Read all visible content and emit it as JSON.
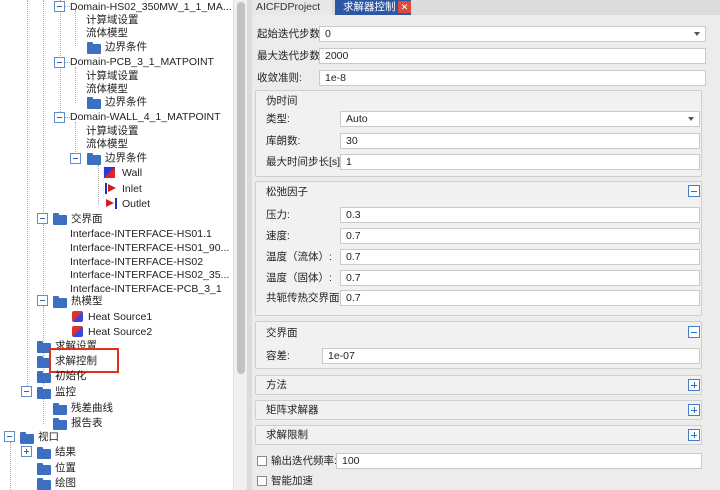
{
  "tree": {
    "domain_hs02": "Domain-HS02_350MW_1_1_MA...",
    "domain_pcb": "Domain-PCB_3_1_MATPOINT",
    "domain_wall": "Domain-WALL_4_1_MATPOINT",
    "calc_domain": "计算域设置",
    "fluid_model": "流体模型",
    "boundary": "边界条件",
    "bc_wall": "Wall",
    "bc_inlet": "Inlet",
    "bc_outlet": "Outlet",
    "interface": "交界面",
    "interfaces": [
      "Interface-INTERFACE-HS01.1",
      "Interface-INTERFACE-HS01_90...",
      "Interface-INTERFACE-HS02",
      "Interface-INTERFACE-HS02_35...",
      "Interface-INTERFACE-PCB_3_1"
    ],
    "thermal_model": "热模型",
    "heat_sources": [
      "Heat Source1",
      "Heat Source2"
    ],
    "solve_settings": "求解设置",
    "solver_control": "求解控制",
    "initialize": "初始化",
    "monitor": "监控",
    "residual": "残差曲线",
    "report": "报告表",
    "view": "视口",
    "results": "结果",
    "position": "位置",
    "plot": "绘图"
  },
  "tabs": {
    "project": "AICFDProject",
    "solver": "求解器控制",
    "close": "✕"
  },
  "form": {
    "start_iter_label": "起始迭代步数:",
    "start_iter_value": "0",
    "max_iter_label": "最大迭代步数:",
    "max_iter_value": "2000",
    "convergence_label": "收敛准则:",
    "convergence_value": "1e-8",
    "pseudo_time": {
      "title": "伪时间",
      "type_label": "类型:",
      "type_value": "Auto",
      "courant_label": "库朗数:",
      "courant_value": "30",
      "max_step_label": "最大时间步长[s]:",
      "max_step_value": "1"
    },
    "relaxation": {
      "title": "松弛因子",
      "pressure_label": "压力:",
      "pressure_value": "0.3",
      "velocity_label": "速度:",
      "velocity_value": "0.7",
      "temp_fluid_label": "温度（流体）:",
      "temp_fluid_value": "0.7",
      "temp_solid_label": "温度（固体）:",
      "temp_solid_value": "0.7",
      "cht_label": "共轭传热交界面:",
      "cht_value": "0.7"
    },
    "interface": {
      "title": "交界面",
      "tolerance_label": "容差:",
      "tolerance_value": "1e-07"
    },
    "method_title": "方法",
    "matrix_title": "矩阵求解器",
    "limits_title": "求解限制",
    "output_freq_label": "输出迭代频率:",
    "output_freq_value": "100",
    "smart_accel_label": "智能加速"
  }
}
